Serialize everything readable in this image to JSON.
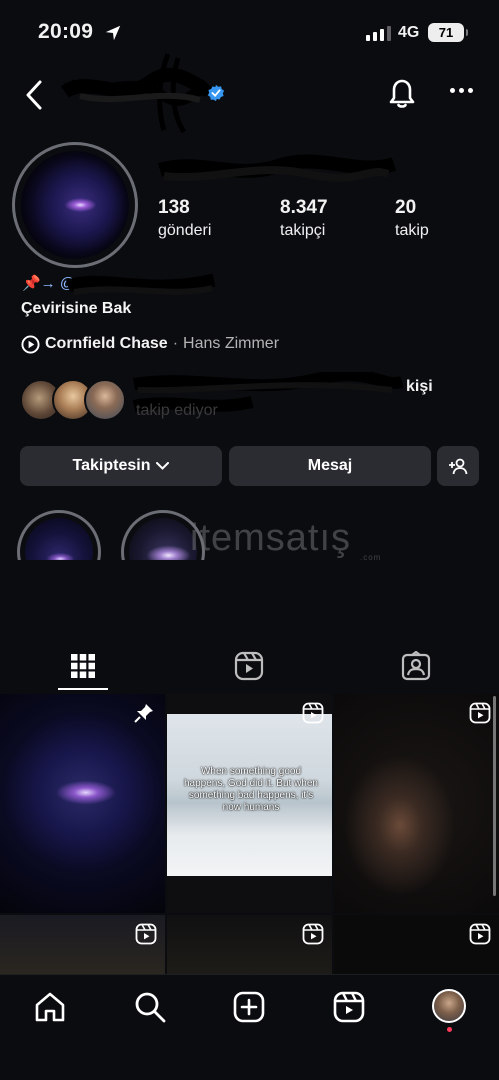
{
  "status_bar": {
    "time": "20:09",
    "network": "4G",
    "battery": "71"
  },
  "profile": {
    "stats": [
      {
        "value": "138",
        "label": "gönderi"
      },
      {
        "value": "8.347",
        "label": "takipçi"
      },
      {
        "value": "20",
        "label": "takip"
      }
    ],
    "bio_prefix": "📌→ @",
    "translate_label": "Çevirisine Bak",
    "music": {
      "title": "Cornfield Chase",
      "separator": "·",
      "artist": "Hans Zimmer"
    },
    "followed_by_suffix": "kişi",
    "followed_by_line2": "takip ediyor"
  },
  "actions": {
    "following_label": "Takiptesin",
    "message_label": "Mesaj"
  },
  "watermark": {
    "brand": "itemsatış",
    "sub": ".com"
  },
  "grid": {
    "quote_text": "When something good happens, God did it. But when something bad happens, it's now humans"
  },
  "icons": {
    "back": "chevron-left-icon",
    "verified": "verified-badge-icon",
    "bell": "bell-icon",
    "more": "more-horizontal-icon",
    "play": "play-circle-icon",
    "add_person": "add-person-icon",
    "grid": "grid-icon",
    "reels": "reels-icon",
    "tagged": "tagged-icon",
    "pin": "pin-icon",
    "home": "home-icon",
    "search": "search-icon",
    "create": "plus-square-icon"
  },
  "colors": {
    "background": "#0b0c10",
    "button": "#2a2c31",
    "verified": "#3797f0",
    "notification": "#ff3b5c"
  }
}
